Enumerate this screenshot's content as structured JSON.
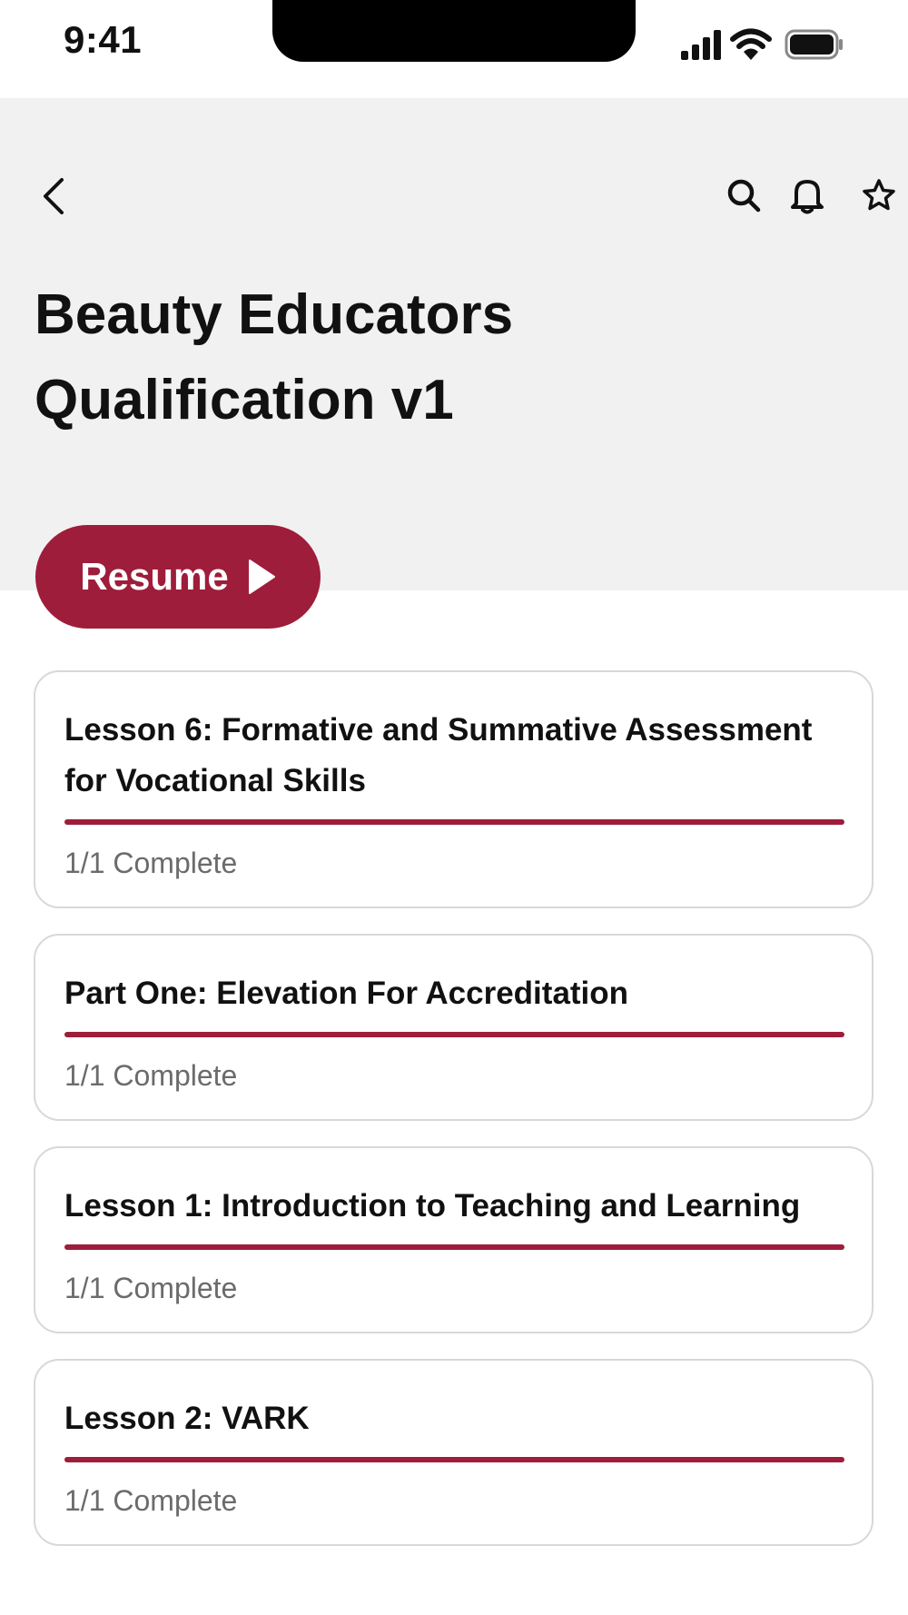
{
  "status_bar": {
    "time": "9:41"
  },
  "header": {
    "title": "Beauty Educators Qualification v1",
    "icons": [
      "chevron-left-icon",
      "search-icon",
      "bell-icon",
      "star-icon"
    ],
    "background": "#f1f1f1"
  },
  "resume_button": {
    "label": "Resume",
    "icon": "play-icon",
    "color": "#9e1d3b"
  },
  "lessons": [
    {
      "title": "Lesson 6: Formative and Summative Assessment for Vocational Skills",
      "progress": 1,
      "status": "1/1 Complete"
    },
    {
      "title": "Part One: Elevation For Accreditation",
      "progress": 1,
      "status": "1/1 Complete"
    },
    {
      "title": "Lesson 1: Introduction to Teaching and Learning",
      "progress": 1,
      "status": "1/1 Complete"
    },
    {
      "title": "Lesson 2: VARK",
      "progress": 1,
      "status": "1/1 Complete"
    }
  ],
  "colors": {
    "accent": "#9e1d3b",
    "card_border": "#d8d8d8",
    "muted_text": "#6b6b6b"
  }
}
